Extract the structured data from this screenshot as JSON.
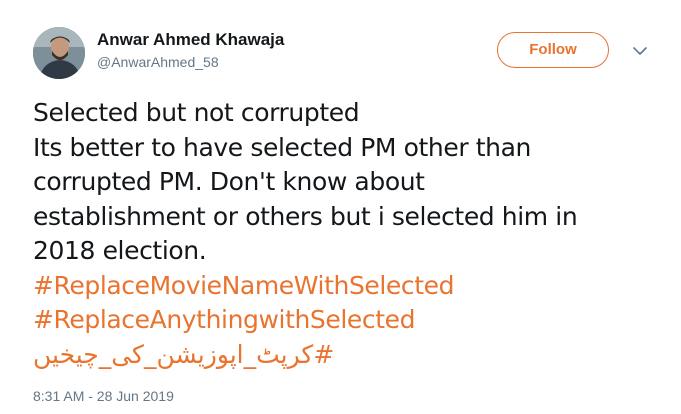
{
  "author": {
    "display_name": "Anwar Ahmed Khawaja",
    "handle": "@AnwarAhmed_58",
    "avatar_icon": "user-photo"
  },
  "actions": {
    "follow_label": "Follow",
    "menu_icon": "chevron-down-icon"
  },
  "tweet": {
    "lines": [
      "Selected but not corrupted",
      "Its better to have selected PM other than",
      "corrupted PM. Don't know about",
      "establishment or others but i selected him in",
      "2018 election."
    ],
    "hashtags": [
      "#ReplaceMovieNameWithSelected",
      "#ReplaceAnythingwithSelected",
      "#کرپٹ_اپوزیشن_کی_چیخیں"
    ]
  },
  "timestamp": "8:31 AM - 28 Jun 2019",
  "colors": {
    "accent": "#e8742f",
    "text": "#14171a",
    "secondary_text": "#657786"
  }
}
